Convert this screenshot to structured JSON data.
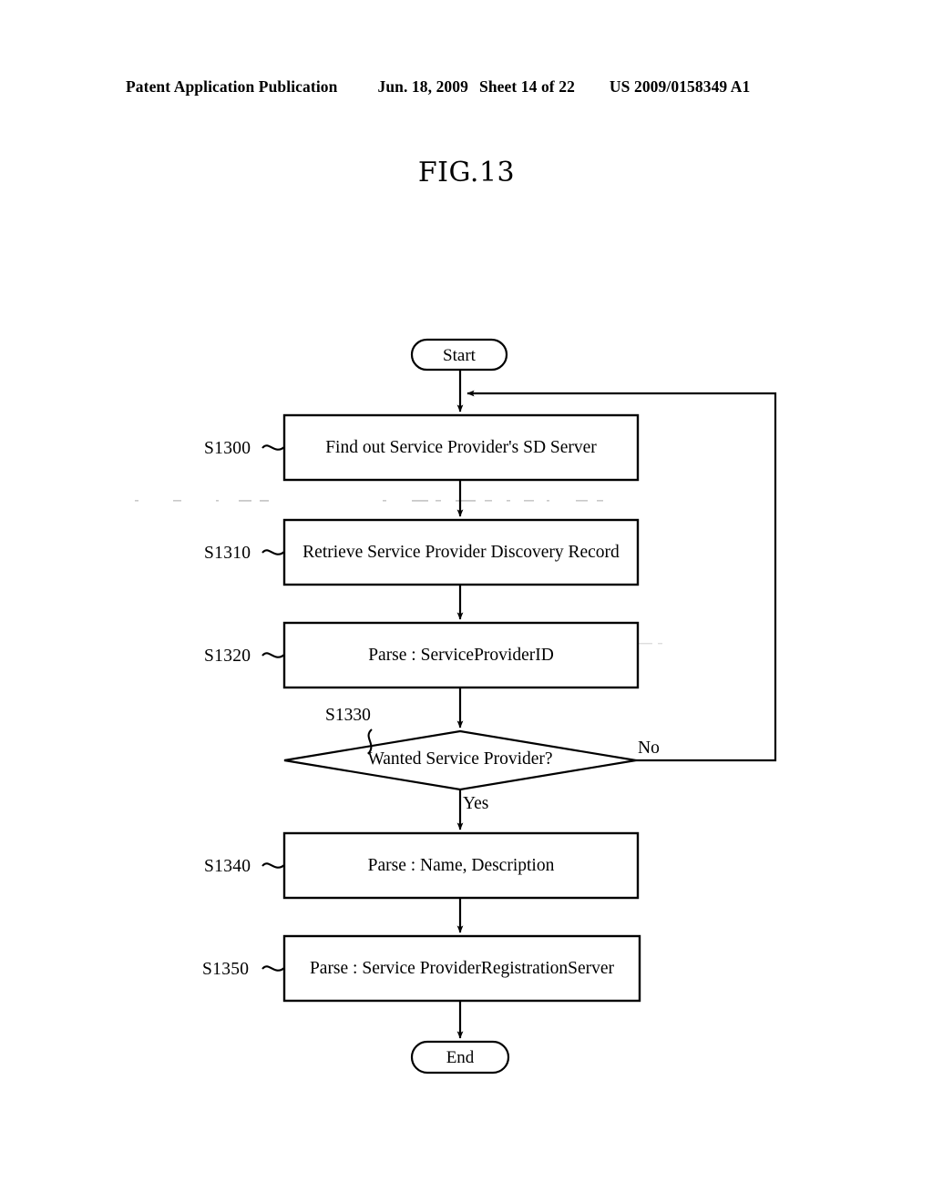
{
  "header": {
    "publication": "Patent Application Publication",
    "date": "Jun. 18, 2009",
    "sheet": "Sheet 14 of 22",
    "patent_number": "US 2009/0158349 A1"
  },
  "figure": {
    "title": "FIG.13"
  },
  "flowchart": {
    "start_label": "Start",
    "end_label": "End",
    "steps": [
      {
        "tag": "S1300",
        "text": "Find out Service Provider's SD Server"
      },
      {
        "tag": "S1310",
        "text": "Retrieve Service Provider Discovery Record"
      },
      {
        "tag": "S1320",
        "text": "Parse : ServiceProviderID"
      },
      {
        "tag": "S1340",
        "text": "Parse  : Name, Description"
      },
      {
        "tag": "S1350",
        "text": "Parse : Service ProviderRegistrationServer"
      }
    ],
    "decision": {
      "tag": "S1330",
      "text": "Wanted Service  Provider?",
      "yes_label": "Yes",
      "no_label": "No"
    },
    "ink_color": "#000000",
    "paper_color": "#ffffff"
  }
}
